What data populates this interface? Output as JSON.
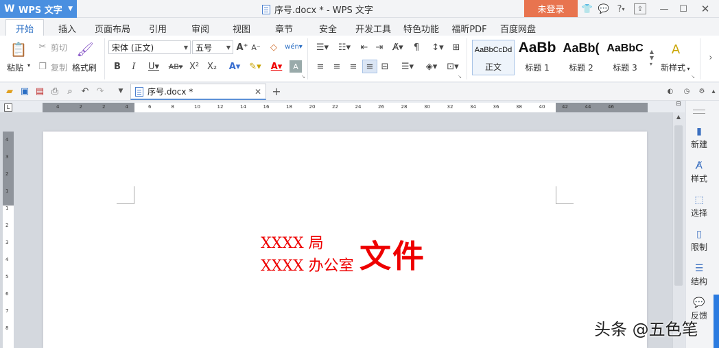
{
  "app": {
    "name": "WPS 文字",
    "doc_title": "序号.docx * - WPS 文字",
    "login": "未登录",
    "help": "?"
  },
  "tabs": [
    "开始",
    "插入",
    "页面布局",
    "引用",
    "审阅",
    "视图",
    "章节",
    "安全",
    "开发工具",
    "特色功能",
    "福昕PDF",
    "百度网盘"
  ],
  "ribbon": {
    "paste": "粘贴",
    "cut": "剪切",
    "copy": "复制",
    "format_painter": "格式刷",
    "font_name": "宋体 (正文)",
    "font_size": "五号",
    "styles": [
      {
        "preview": "AaBbCcDd",
        "name": "正文"
      },
      {
        "preview": "AaBb",
        "name": "标题 1"
      },
      {
        "preview": "AaBb(",
        "name": "标题 2"
      },
      {
        "preview": "AaBbC",
        "name": "标题 3"
      }
    ],
    "new_style": "新样式"
  },
  "doc_tab": {
    "name": "序号.docx *"
  },
  "ruler_ticks": [
    "4",
    "2",
    "2",
    "4",
    "6",
    "8",
    "10",
    "12",
    "14",
    "16",
    "18",
    "20",
    "22",
    "24",
    "26",
    "28",
    "30",
    "32",
    "34",
    "36",
    "38",
    "40",
    "42",
    "44",
    "46"
  ],
  "vruler_ticks": [
    "4",
    "3",
    "2",
    "1",
    "1",
    "2",
    "3",
    "4",
    "5",
    "6",
    "7",
    "8"
  ],
  "document": {
    "line1": "XXXX 局",
    "line2": "XXXX 办公室",
    "big": "文件"
  },
  "side_panel": [
    "新建",
    "样式",
    "选择",
    "限制",
    "结构",
    "反馈"
  ],
  "watermark": "头条 @五色笔",
  "colors": {
    "accent": "#4a8fe0",
    "login_bg": "#e8744f",
    "doc_red": "#ee0000"
  }
}
